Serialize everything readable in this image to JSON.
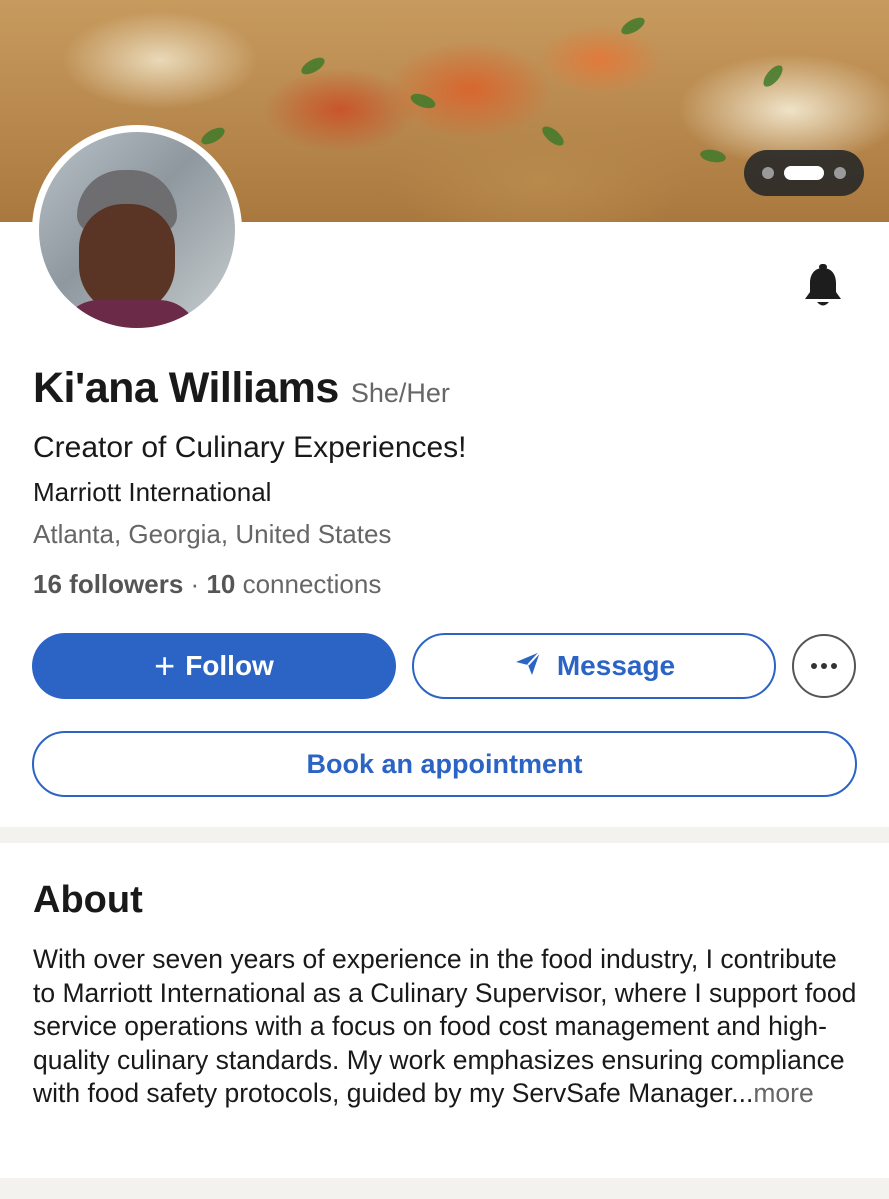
{
  "profile": {
    "name": "Ki'ana Williams",
    "pronouns": "She/Her",
    "headline": "Creator of Culinary Experiences!",
    "company": "Marriott International",
    "location": "Atlanta, Georgia, United States",
    "followers_count": "16",
    "followers_label": "followers",
    "separator": "·",
    "connections_count": "10",
    "connections_label": "connections"
  },
  "actions": {
    "follow_icon": "+",
    "follow_label": "Follow",
    "message_label": "Message",
    "book_label": "Book an appointment",
    "icons": {
      "follow": "plus-icon",
      "message": "paper-plane-icon",
      "more": "ellipsis-icon",
      "notify": "bell-icon"
    }
  },
  "about": {
    "title": "About",
    "text": "With over seven years of experience in the food industry, I contribute to Marriott International as a Culinary Supervisor, where I support food service operations with a focus on food cost management and high-quality culinary standards. My work emphasizes ensuring compliance with food safety protocols, guided by my ServSafe Manager...",
    "more_label": "more"
  },
  "colors": {
    "primary": "#2b64c4",
    "text": "#191919",
    "muted": "#666666",
    "divider": "#f3f2ef"
  }
}
